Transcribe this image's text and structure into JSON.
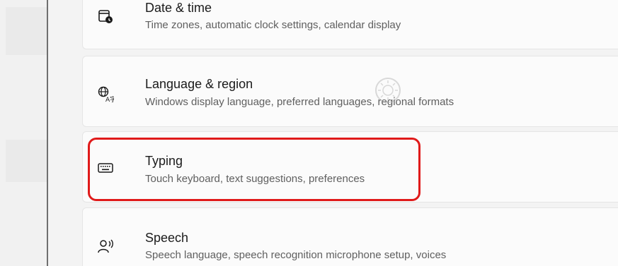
{
  "settings": {
    "items": [
      {
        "title": "Date & time",
        "subtitle": "Time zones, automatic clock settings, calendar display",
        "icon": "clock-calendar-icon"
      },
      {
        "title": "Language & region",
        "subtitle": "Windows display language, preferred languages, regional formats",
        "icon": "language-icon"
      },
      {
        "title": "Typing",
        "subtitle": "Touch keyboard, text suggestions, preferences",
        "icon": "keyboard-icon"
      },
      {
        "title": "Speech",
        "subtitle": "Speech language, speech recognition microphone setup, voices",
        "icon": "speech-icon"
      }
    ],
    "chevron": "›"
  },
  "colors": {
    "highlight": "#e01a1a",
    "card_bg": "#fbfbfb",
    "page_bg": "#f3f3f3"
  }
}
